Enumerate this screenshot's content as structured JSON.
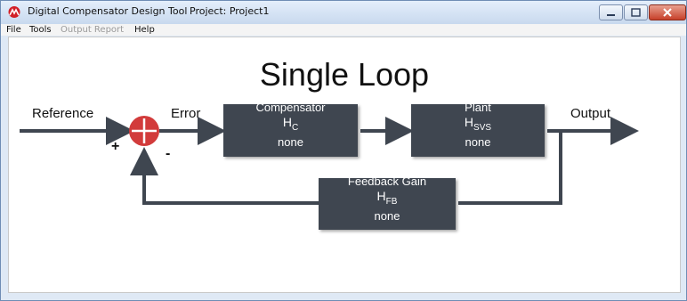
{
  "window": {
    "app_title": "Digital Compensator Design Tool",
    "project_label": "Project: Project1"
  },
  "menu": [
    {
      "label": "File",
      "enabled": true
    },
    {
      "label": "Tools",
      "enabled": true
    },
    {
      "label": "Output Report",
      "enabled": false
    },
    {
      "label": "Help",
      "enabled": true
    }
  ],
  "diagram": {
    "title": "Single Loop",
    "labels": {
      "reference": "Reference",
      "error": "Error",
      "output": "Output",
      "plus": "+",
      "minus": "-"
    },
    "blocks": {
      "compensator": {
        "name": "Compensator",
        "symbol": "H",
        "subscript": "C",
        "value": "none"
      },
      "plant": {
        "name": "Plant",
        "symbol": "H",
        "subscript": "SVS",
        "value": "none"
      },
      "feedback": {
        "name": "Feedback Gain",
        "symbol": "H",
        "subscript": "FB",
        "value": "none"
      }
    }
  },
  "colors": {
    "block_fill": "#3f4650",
    "wire": "#3f4650",
    "summing_junction": "#d23b3b"
  }
}
